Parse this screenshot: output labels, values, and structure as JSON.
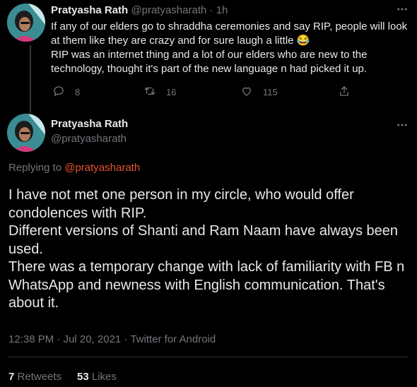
{
  "reply_tweet": {
    "author_name": "Pratyasha Rath",
    "handle": "@pratyasharath",
    "separator": "·",
    "time": "1h",
    "text": "If any of our elders go to shraddha ceremonies and say RIP, people will look at them like they are crazy and for sure laugh a little 😂\nRIP was an internet thing and a lot of our elders who are new to the technology, thought it's part of the new language n had picked it up.",
    "replies": "8",
    "retweets": "16",
    "likes": "115"
  },
  "main_tweet": {
    "author_name": "Pratyasha Rath",
    "handle": "@pratyasharath",
    "replying_to_label": "Replying to",
    "replying_to_handle": "@pratyasharath",
    "text": "I have not met one person in my circle, who would offer condolences with RIP.\nDifferent versions of Shanti and Ram Naam have always been used.\nThere was a temporary change with lack of familiarity with FB n WhatsApp and newness with English communication. That's about it.",
    "timestamp": "12:38 PM · Jul 20, 2021 · Twitter for Android",
    "retweets_count": "7",
    "retweets_label": "Retweets",
    "likes_count": "53",
    "likes_label": "Likes"
  },
  "icons": {
    "more": "more-icon",
    "reply": "reply-icon",
    "retweet": "retweet-icon",
    "like": "like-icon",
    "share": "share-icon"
  },
  "colors": {
    "background": "#000000",
    "text": "#e7e9ea",
    "muted": "#71767b",
    "mention": "#e8542e",
    "divider": "#2f3336"
  }
}
